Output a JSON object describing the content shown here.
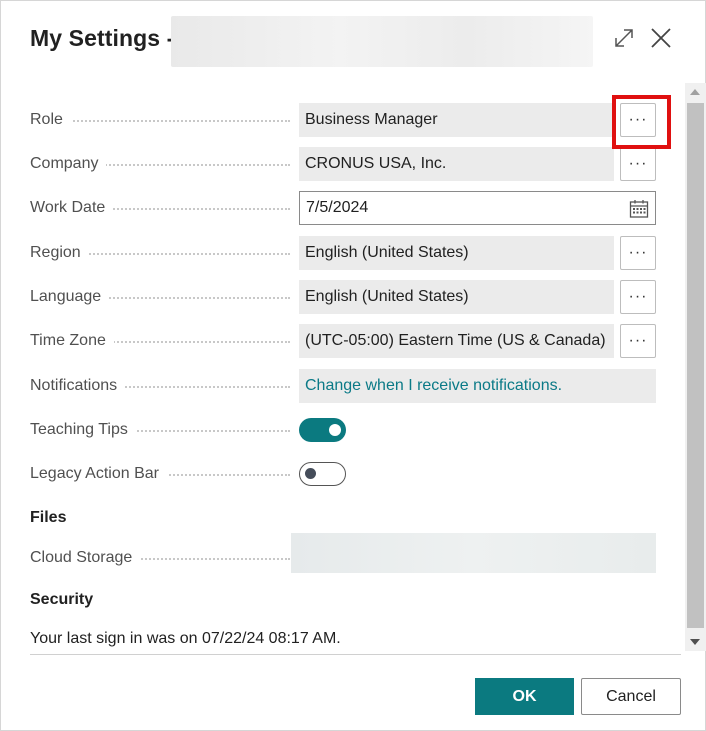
{
  "dialog": {
    "title": "My Settings -",
    "expand_icon": "expand-icon",
    "close_icon": "close-icon"
  },
  "fields": {
    "role": {
      "label": "Role",
      "value": "Business Manager",
      "lookup": "···"
    },
    "company": {
      "label": "Company",
      "value": "CRONUS USA, Inc.",
      "lookup": "···"
    },
    "work_date": {
      "label": "Work Date",
      "value": "7/5/2024",
      "icon": "calendar-icon"
    },
    "region": {
      "label": "Region",
      "value": "English (United States)",
      "lookup": "···"
    },
    "language": {
      "label": "Language",
      "value": "English (United States)",
      "lookup": "···"
    },
    "time_zone": {
      "label": "Time Zone",
      "value": "(UTC-05:00) Eastern Time (US & Canada)",
      "lookup": "···"
    },
    "notifications": {
      "label": "Notifications",
      "value": "Change when I receive notifications."
    },
    "teaching_tips": {
      "label": "Teaching Tips",
      "state": "on"
    },
    "legacy_action_bar": {
      "label": "Legacy Action Bar",
      "state": "off"
    }
  },
  "files": {
    "heading": "Files",
    "cloud_storage": {
      "label": "Cloud Storage"
    }
  },
  "security": {
    "heading": "Security",
    "last_sign_in": "Your last sign in was on 07/22/24 08:17 AM."
  },
  "footer": {
    "ok_label": "OK",
    "cancel_label": "Cancel"
  },
  "colors": {
    "accent": "#0b7a80",
    "link": "#0b7a87",
    "highlight": "#e01010",
    "field_bg": "#ebebeb"
  }
}
